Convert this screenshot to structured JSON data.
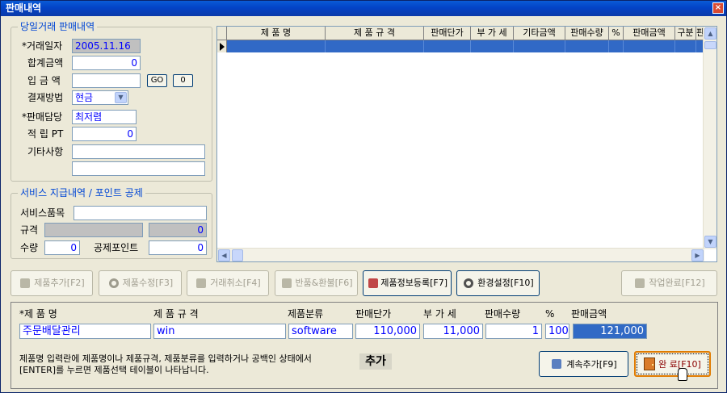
{
  "window": {
    "title": "판매내역",
    "close": "×"
  },
  "today_sales": {
    "title": "당일거래 판매내역",
    "date_label": "*거래일자",
    "date_value": "2005.11.16",
    "total_label": "합계금액",
    "total_value": "0",
    "deposit_label": "입 금 액",
    "deposit_value": "",
    "go_label": "GO",
    "zero_label": "0",
    "payment_label": "결재방법",
    "payment_value": "현금",
    "staff_label": "*판매담당",
    "staff_value": "최저렴",
    "points_label": "적 립 PT",
    "points_value": "0",
    "notes_label": "기타사항",
    "notes_value1": "",
    "notes_value2": ""
  },
  "service": {
    "title": "서비스 지급내역 / 포인트 공제",
    "item_label": "서비스품목",
    "item_value": "",
    "spec_label": "규격",
    "spec_value": "",
    "spec_amount": "0",
    "qty_label": "수량",
    "qty_value": "0",
    "deduct_label": "공제포인트",
    "deduct_value": "0"
  },
  "grid": {
    "columns": [
      "제 품 명",
      "제 품 규 격",
      "판매단가",
      "부 가 세",
      "기타금액",
      "판매수량",
      "%",
      "판매금액",
      "구분",
      "판"
    ]
  },
  "toolbar": {
    "add": "제품추가[F2]",
    "edit": "제품수정[F3]",
    "cancel": "거래취소[F4]",
    "return": "반품&환불[F6]",
    "register": "제품정보등록[F7]",
    "settings": "환경설정[F10]",
    "finish": "작업완료[F12]"
  },
  "entry": {
    "h_name": "*제 품 명",
    "h_spec": "제 품 규 격",
    "h_cat": "제품분류",
    "h_price": "판매단가",
    "h_vat": "부 가 세",
    "h_qty": "판매수량",
    "h_pct": "%",
    "h_amount": "판매금액",
    "name": "주문배달관리",
    "spec": "win",
    "category": "software",
    "price": "110,000",
    "vat": "11,000",
    "qty": "1",
    "pct": "100",
    "amount": "121,000",
    "hint1": "제품명 입력란에 제품명이나 제품규격, 제품분류를 입력하거나 공백인 상태에서",
    "hint2": "[ENTER]를 누르면 제품선택 테이블이 나타납니다.",
    "add_label": "추가",
    "continue_btn": "계속추가[F9]",
    "done_btn": "완 료[F10]"
  }
}
